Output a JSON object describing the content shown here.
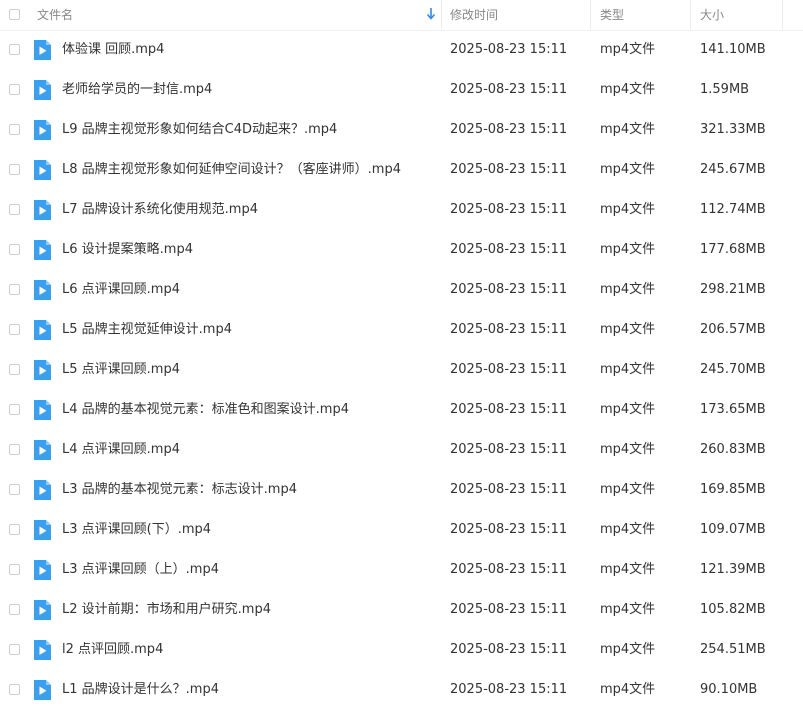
{
  "header": {
    "name_label": "文件名",
    "modified_label": "修改时间",
    "type_label": "类型",
    "size_label": "大小"
  },
  "colors": {
    "file_icon": "#3b9ff0",
    "sort_arrow": "#2d8cf0"
  },
  "icons": {
    "file": "video-file-icon",
    "sort": "sort-down-arrow-icon"
  },
  "files": [
    {
      "name": "体验课 回顾.mp4",
      "modified": "2025-08-23 15:11",
      "type": "mp4文件",
      "size": "141.10MB"
    },
    {
      "name": "老师给学员的一封信.mp4",
      "modified": "2025-08-23 15:11",
      "type": "mp4文件",
      "size": "1.59MB"
    },
    {
      "name": "L9 品牌主视觉形象如何结合C4D动起来？.mp4",
      "modified": "2025-08-23 15:11",
      "type": "mp4文件",
      "size": "321.33MB"
    },
    {
      "name": "L8 品牌主视觉形象如何延伸空间设计？（客座讲师）.mp4",
      "modified": "2025-08-23 15:11",
      "type": "mp4文件",
      "size": "245.67MB"
    },
    {
      "name": "L7 品牌设计系统化使用规范.mp4",
      "modified": "2025-08-23 15:11",
      "type": "mp4文件",
      "size": "112.74MB"
    },
    {
      "name": "L6 设计提案策略.mp4",
      "modified": "2025-08-23 15:11",
      "type": "mp4文件",
      "size": "177.68MB"
    },
    {
      "name": "L6 点评课回顾.mp4",
      "modified": "2025-08-23 15:11",
      "type": "mp4文件",
      "size": "298.21MB"
    },
    {
      "name": "L5 品牌主视觉延伸设计.mp4",
      "modified": "2025-08-23 15:11",
      "type": "mp4文件",
      "size": "206.57MB"
    },
    {
      "name": "L5 点评课回顾.mp4",
      "modified": "2025-08-23 15:11",
      "type": "mp4文件",
      "size": "245.70MB"
    },
    {
      "name": "L4 品牌的基本视觉元素：标准色和图案设计.mp4",
      "modified": "2025-08-23 15:11",
      "type": "mp4文件",
      "size": "173.65MB"
    },
    {
      "name": "L4 点评课回顾.mp4",
      "modified": "2025-08-23 15:11",
      "type": "mp4文件",
      "size": "260.83MB"
    },
    {
      "name": "L3 品牌的基本视觉元素：标志设计.mp4",
      "modified": "2025-08-23 15:11",
      "type": "mp4文件",
      "size": "169.85MB"
    },
    {
      "name": "L3 点评课回顾(下）.mp4",
      "modified": "2025-08-23 15:11",
      "type": "mp4文件",
      "size": "109.07MB"
    },
    {
      "name": "L3 点评课回顾（上）.mp4",
      "modified": "2025-08-23 15:11",
      "type": "mp4文件",
      "size": "121.39MB"
    },
    {
      "name": "L2 设计前期：市场和用户研究.mp4",
      "modified": "2025-08-23 15:11",
      "type": "mp4文件",
      "size": "105.82MB"
    },
    {
      "name": "l2 点评回顾.mp4",
      "modified": "2025-08-23 15:11",
      "type": "mp4文件",
      "size": "254.51MB"
    },
    {
      "name": "L1 品牌设计是什么？.mp4",
      "modified": "2025-08-23 15:11",
      "type": "mp4文件",
      "size": "90.10MB"
    }
  ]
}
